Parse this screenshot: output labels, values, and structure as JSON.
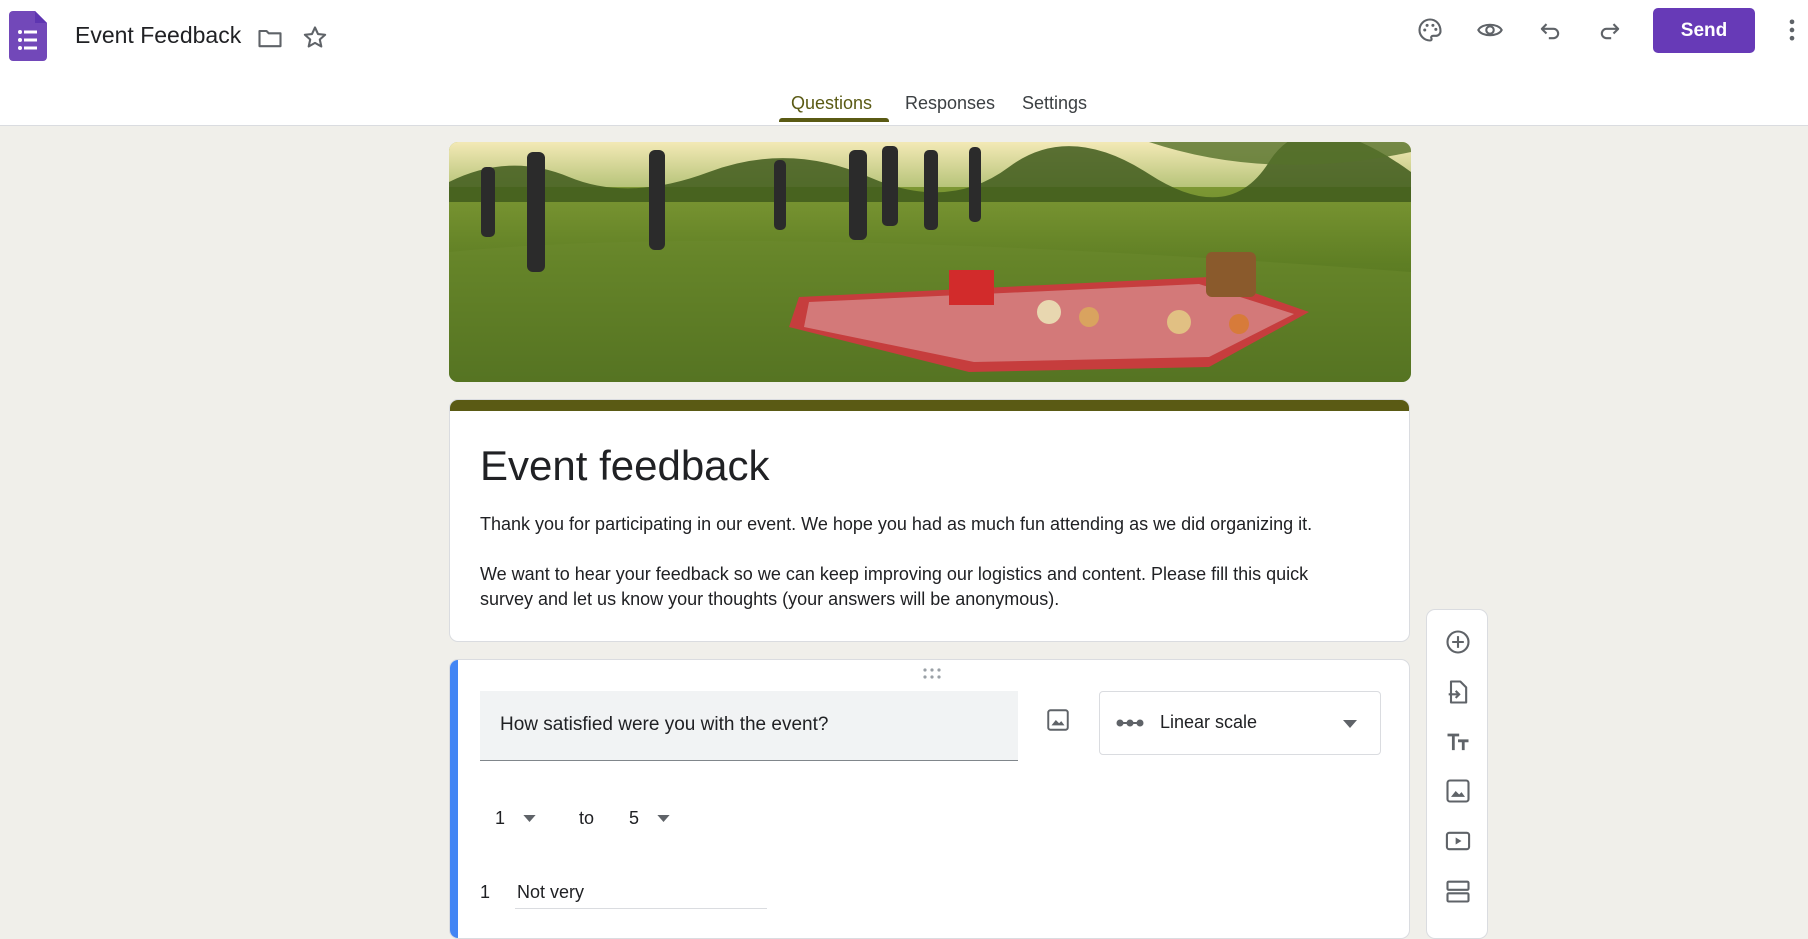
{
  "app": {
    "doc_title": "Event Feedback",
    "send_label": "Send",
    "brand_color": "#673ab7",
    "theme_color": "#5a5a14"
  },
  "toolbar_icons": [
    "folder-icon",
    "star-icon",
    "palette-icon",
    "eye-icon",
    "undo-icon",
    "redo-icon",
    "more-vert-icon"
  ],
  "tabs": [
    {
      "label": "Questions",
      "active": true
    },
    {
      "label": "Responses",
      "active": false
    },
    {
      "label": "Settings",
      "active": false
    }
  ],
  "form": {
    "title": "Event feedback",
    "description": "Thank you for participating in our event. We hope you had as much fun attending as we did organizing it.\n\nWe want to hear your feedback so we can keep improving our logistics and content. Please fill this quick survey and let us know your thoughts (your answers will be anonymous)."
  },
  "question": {
    "text": "How satisfied were you with the event?",
    "type_label": "Linear scale",
    "scale_from": "1",
    "scale_to_word": "to",
    "scale_to": "5",
    "low_index": "1",
    "low_label": "Not very"
  },
  "side_toolbar": [
    "add-question-icon",
    "import-questions-icon",
    "add-title-icon",
    "add-image-icon",
    "add-video-icon",
    "add-section-icon"
  ]
}
